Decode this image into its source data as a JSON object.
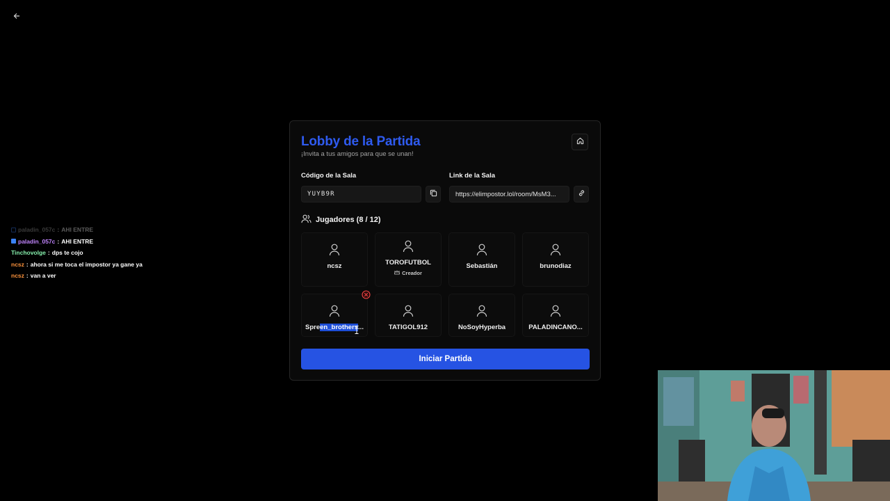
{
  "nav": {
    "back_icon": "arrow-left-icon"
  },
  "chat": {
    "messages": [
      {
        "user": "paladin_057c",
        "text": "AHI ENTRE",
        "user_color": "#a3a3a3",
        "badge": "square",
        "faded": true
      },
      {
        "user": "paladin_057c",
        "text": "AHI ENTRE",
        "user_color": "#c084fc",
        "badge": "square",
        "faded": false
      },
      {
        "user": "Tinchovolge",
        "text": "dps te cojo",
        "user_color": "#86efac",
        "badge": "",
        "faded": false
      },
      {
        "user": "ncsz",
        "text": "ahora si me toca el impostor ya gane ya",
        "user_color": "#fb923c",
        "badge": "",
        "faded": false
      },
      {
        "user": "ncsz",
        "text": "van a ver",
        "user_color": "#fb923c",
        "badge": "",
        "faded": false
      }
    ]
  },
  "lobby": {
    "title": "Lobby de la Partida",
    "subtitle": "¡Invita a tus amigos para que se unan!",
    "home_icon": "home-icon",
    "room_code_label": "Código de la Sala",
    "room_code": "YUYB9R",
    "room_link_label": "Link de la Sala",
    "room_link": "https://elimpostor.lol/room/MsM3...",
    "players_label": "Jugadores (8 / 12)",
    "players": [
      {
        "name": "ncsz",
        "role": ""
      },
      {
        "name": "TOROFUTBOL",
        "role": "Creador"
      },
      {
        "name": "Sebastián",
        "role": ""
      },
      {
        "name": "brunodiaz",
        "role": ""
      },
      {
        "name_pre": "Spre",
        "name_sel": "en_brothers",
        "name_post": "...",
        "role": ""
      },
      {
        "name": "TATIGOL912",
        "role": ""
      },
      {
        "name": "NoSoyHyperba",
        "role": ""
      },
      {
        "name": "PALADINCANO...",
        "role": ""
      }
    ],
    "start_button": "Iniciar Partida",
    "colors": {
      "accent": "#2653e3",
      "title": "#2f5bf0",
      "kick": "#ef4444"
    }
  }
}
